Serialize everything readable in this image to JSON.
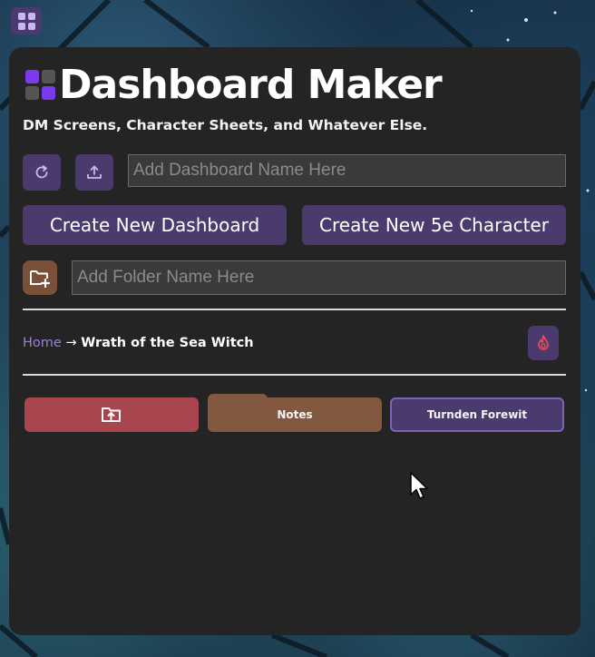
{
  "app": {
    "icon": "dashboard-grid-icon",
    "title": "Dashboard Maker",
    "subtitle": "DM Screens, Character Sheets, and Whatever Else.",
    "logo_colors": [
      "#7c3aed",
      "#555555",
      "#555555",
      "#7c3aed"
    ]
  },
  "toolbar": {
    "refresh_icon": "refresh-icon",
    "upload_icon": "upload-icon",
    "dashboard_name": {
      "value": "",
      "placeholder": "Add Dashboard Name Here"
    },
    "create_dashboard_label": "Create New Dashboard",
    "create_character_label": "Create New 5e Character"
  },
  "folder_bar": {
    "add_folder_icon": "add-folder-icon",
    "folder_name": {
      "value": "",
      "placeholder": "Add Folder Name Here"
    }
  },
  "breadcrumb": {
    "home": "Home",
    "separator": "→",
    "current": "Wrath of the Sea Witch",
    "action_icon": "fire-icon"
  },
  "folders": [
    {
      "kind": "parent",
      "icon": "folder-up-icon",
      "label": ""
    },
    {
      "kind": "folder",
      "label": "Notes"
    },
    {
      "kind": "dashboard",
      "label": "Turnden Forewit"
    }
  ],
  "colors": {
    "accent_purple": "#4b3a6e",
    "folder_red": "#a9454f",
    "folder_brown": "#825940",
    "panel_bg": "#242424",
    "link_purple": "#9b82d6",
    "fire_red": "#e04b5a"
  }
}
